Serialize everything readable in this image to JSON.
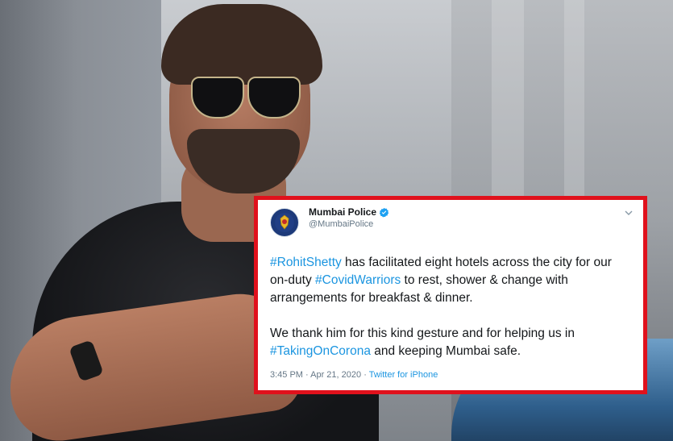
{
  "tweet": {
    "display_name": "Mumbai Police",
    "handle": "@MumbaiPolice",
    "paragraph1": {
      "tag1": "#RohitShetty",
      "text1": " has facilitated eight hotels across the city for our on-duty ",
      "tag2": "#CovidWarriors",
      "text2": " to rest, shower & change with arrangements for breakfast & dinner."
    },
    "paragraph2": {
      "text1": "We thank him for this kind gesture and for helping us in ",
      "tag1": "#TakingOnCorona",
      "text2": " and keeping Mumbai safe."
    },
    "timestamp": "3:45 PM · Apr 21, 2020",
    "separator": " · ",
    "source": "Twitter for iPhone",
    "icons": {
      "avatar": "police-badge-icon",
      "verified": "verified-badge-icon",
      "menu": "chevron-down-icon"
    }
  },
  "colors": {
    "frame_border": "#e0111c",
    "hashtag": "#1b95e0",
    "text": "#14171a",
    "muted": "#657786"
  }
}
